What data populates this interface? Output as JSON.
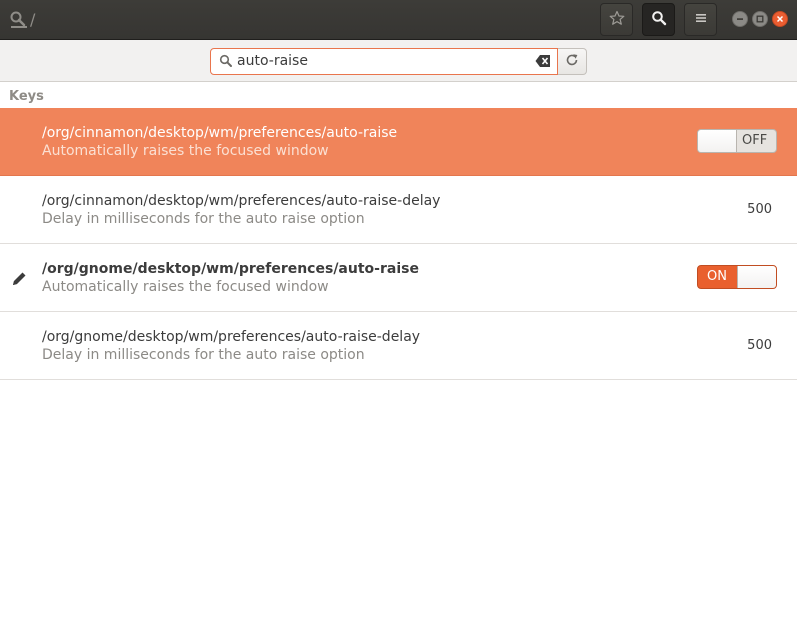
{
  "header": {
    "path": "/",
    "icons": {
      "app": "dconf-editor-icon",
      "bookmark": "star-icon",
      "search": "search-icon",
      "menu": "hamburger-menu-icon"
    }
  },
  "search": {
    "value": "auto-raise"
  },
  "section": {
    "label": "Keys"
  },
  "colors": {
    "accent": "#f0845a",
    "switch_on": "#e9602e",
    "close": "#ea5d31"
  },
  "keys": [
    {
      "path": "/org/cinnamon/desktop/wm/preferences/auto-raise",
      "description": "Automatically raises the focused window",
      "value_type": "boolean",
      "value": "OFF",
      "selected": true,
      "modified": false
    },
    {
      "path": "/org/cinnamon/desktop/wm/preferences/auto-raise-delay",
      "description": "Delay in milliseconds for the auto raise option",
      "value_type": "number",
      "value": "500",
      "selected": false,
      "modified": false
    },
    {
      "path": "/org/gnome/desktop/wm/preferences/auto-raise",
      "description": "Automatically raises the focused window",
      "value_type": "boolean",
      "value": "ON",
      "selected": false,
      "modified": true
    },
    {
      "path": "/org/gnome/desktop/wm/preferences/auto-raise-delay",
      "description": "Delay in milliseconds for the auto raise option",
      "value_type": "number",
      "value": "500",
      "selected": false,
      "modified": false
    }
  ]
}
